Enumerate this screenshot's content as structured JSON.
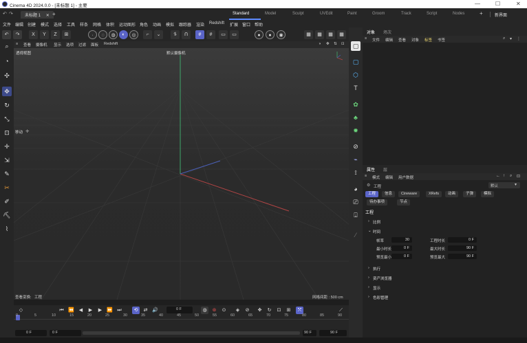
{
  "window": {
    "title": "Cinema 4D 2024.0.0 - [未标题 1] - 主要",
    "minimize": "—",
    "maximize": "☐",
    "close": "✕"
  },
  "tabs": {
    "document": "未标题 1",
    "document_close": "✕",
    "add": "+",
    "layouts": [
      "Standard",
      "Model",
      "Sculpt",
      "UVEdit",
      "Paint",
      "Groom",
      "Track",
      "Script",
      "Nodes"
    ],
    "layouts_add": "+",
    "new_interface": "新界面"
  },
  "menu": [
    "文件",
    "编辑",
    "创建",
    "模式",
    "选择",
    "工具",
    "样条",
    "网格",
    "体积",
    "运动图形",
    "角色",
    "动画",
    "模拟",
    "跟踪器",
    "渲染",
    "Redshift",
    "扩展",
    "窗口",
    "帮助"
  ],
  "toolbar": {
    "axis_x": "X",
    "axis_y": "Y",
    "axis_z": "Z"
  },
  "viewport": {
    "menu": [
      "查看",
      "摄像机",
      "显示",
      "选项",
      "过滤",
      "面板",
      "Redshift"
    ],
    "view_name": "透视视图",
    "camera": "默认摄像机",
    "move_label": "移动",
    "status_left": "查看变换:",
    "status_left_value": "工程",
    "status_right": "网格间距 : 500 cm",
    "accent_green": "#3fa86b",
    "accent_red": "#b04444",
    "accent_blue": "#4a5fb8"
  },
  "object_manager": {
    "tabs": [
      "对象",
      "场次"
    ],
    "menu": [
      "文件",
      "编辑",
      "查看",
      "对象",
      "标签",
      "书签"
    ]
  },
  "attribute_manager": {
    "tabs": [
      "属性",
      "层"
    ],
    "menu": [
      "模式",
      "编辑",
      "用户数据"
    ],
    "object_label": "工程",
    "preset": "默认",
    "tab_row1": [
      "工程",
      "信息",
      "Cineware",
      "XRefs",
      "动画",
      "子弹",
      "模拟"
    ],
    "tab_row2": [
      "待办事项",
      "节点"
    ],
    "section_title": "工程",
    "groups": [
      "比例",
      "时间"
    ],
    "time_fields": {
      "fps_label": "帧率",
      "fps_value": "30",
      "length_label": "工程时长",
      "length_value": "0 F",
      "min_label": "最小时长",
      "min_value": "0 F",
      "max_label": "最大时长",
      "max_value": "90 F",
      "pmin_label": "预览最小",
      "pmin_value": "0 F",
      "pmax_label": "预览最大",
      "pmax_value": "90 F"
    },
    "collapsed_groups": [
      "执行",
      "资产浏览器",
      "显示",
      "色彩管理"
    ]
  },
  "timeline": {
    "current_frame": "0 F",
    "ticks": [
      "0",
      "5",
      "10",
      "15",
      "20",
      "25",
      "30",
      "35",
      "40",
      "45",
      "50",
      "55",
      "60",
      "65",
      "70",
      "75",
      "80",
      "85",
      "90"
    ],
    "start": "0 F",
    "start2": "0 F",
    "end": "90 F",
    "end2": "90 F",
    "accent": "#5a64c8"
  }
}
